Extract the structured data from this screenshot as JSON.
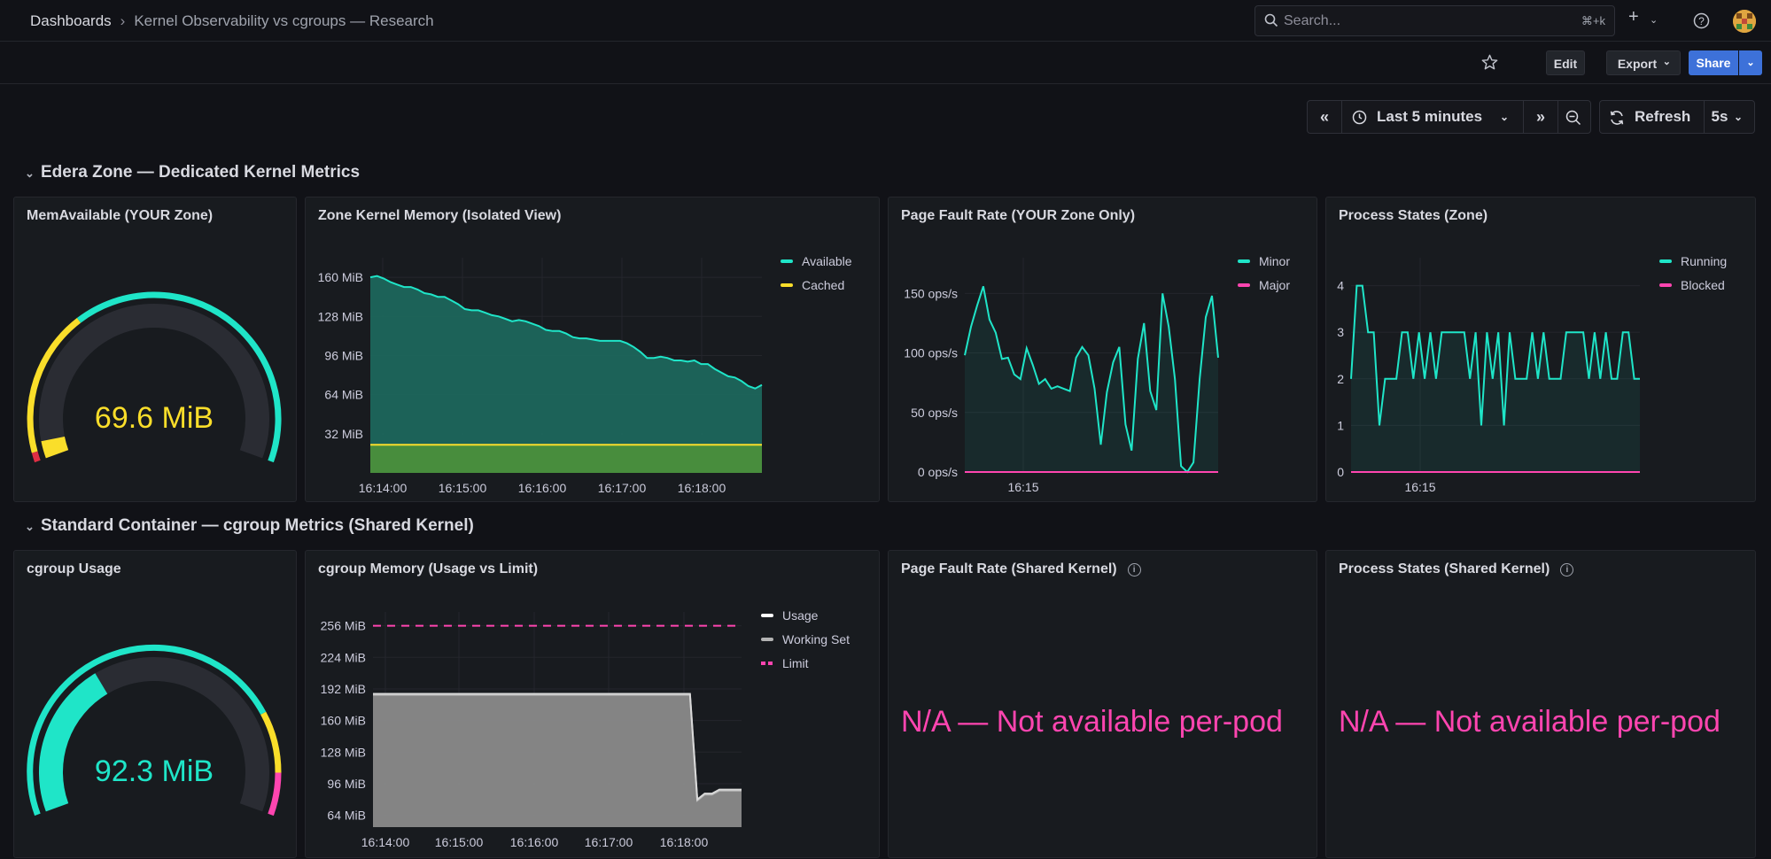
{
  "breadcrumb": {
    "root": "Dashboards",
    "separator": "›",
    "current": "Kernel Observability vs cgroups — Research"
  },
  "search": {
    "placeholder": "Search...",
    "shortcut": "⌘+k"
  },
  "toolbar": {
    "edit": "Edit",
    "export": "Export",
    "share": "Share"
  },
  "time": {
    "range": "Last 5 minutes",
    "refresh": "Refresh",
    "interval": "5s"
  },
  "rows": [
    {
      "title": "Edera Zone — Dedicated Kernel Metrics"
    },
    {
      "title": "Standard Container — cgroup Metrics (Shared Kernel)"
    }
  ],
  "colors": {
    "green": "#1fe5c8",
    "yellow": "#fade2a",
    "pink": "#ff45b0",
    "red": "#e02f44",
    "white": "#ffffff",
    "gray": "#b3b3b3"
  },
  "panels": {
    "mem_available": {
      "title": "MemAvailable (YOUR Zone)",
      "value": "69.6 MiB"
    },
    "zone_kernel": {
      "title": "Zone Kernel Memory (Isolated View)"
    },
    "page_fault_zone": {
      "title": "Page Fault Rate (YOUR Zone Only)"
    },
    "proc_zone": {
      "title": "Process States (Zone)"
    },
    "cgroup_usage": {
      "title": "cgroup Usage",
      "value": "92.3 MiB"
    },
    "cgroup_memory": {
      "title": "cgroup Memory (Usage vs Limit)"
    },
    "page_fault_shared": {
      "title": "Page Fault Rate (Shared Kernel)",
      "text": "N/A — Not available per-pod"
    },
    "proc_shared": {
      "title": "Process States (Shared Kernel)",
      "text": "N/A — Not available per-pod"
    }
  },
  "chart_data": [
    {
      "panel": "mem_available",
      "type": "gauge",
      "value": 69.6,
      "unit": "MiB",
      "fraction": 0.04,
      "thresholds": [
        "red",
        "yellow",
        "green"
      ]
    },
    {
      "panel": "zone_kernel",
      "type": "area",
      "yticks": [
        "160 MiB",
        "128 MiB",
        "96 MiB",
        "64 MiB",
        "32 MiB"
      ],
      "ylim": [
        0,
        176
      ],
      "xticks": [
        "16:14:00",
        "16:15:00",
        "16:16:00",
        "16:17:00",
        "16:18:00"
      ],
      "series": [
        {
          "name": "Available",
          "color": "#1fe5c8",
          "values": [
            160,
            161,
            159,
            156,
            154,
            152,
            152,
            150,
            147,
            146,
            144,
            144,
            141,
            138,
            134,
            133,
            133,
            131,
            129,
            128,
            126,
            124,
            125,
            124,
            122,
            120,
            117,
            116,
            116,
            114,
            111,
            110,
            110,
            109,
            108,
            108,
            108,
            108,
            106,
            103,
            99,
            94,
            94,
            95,
            94,
            92,
            92,
            91,
            92,
            89,
            89,
            85,
            82,
            79,
            78,
            75,
            71,
            69,
            72
          ]
        },
        {
          "name": "Cached",
          "color": "#fade2a",
          "values": [
            23,
            23,
            23,
            23,
            23,
            23,
            23,
            23,
            23,
            23,
            23,
            23,
            23,
            23,
            23,
            23,
            23,
            23,
            23,
            23,
            23,
            23,
            23,
            23,
            23,
            23,
            23,
            23,
            23,
            23,
            23,
            23,
            23,
            23,
            23,
            23,
            23,
            23,
            23,
            23,
            23,
            23,
            23,
            23,
            23,
            23,
            23,
            23,
            23,
            23,
            23,
            23,
            23,
            23,
            23,
            23,
            23,
            23,
            23
          ]
        }
      ]
    },
    {
      "panel": "page_fault_zone",
      "type": "line",
      "yticks": [
        "150 ops/s",
        "100 ops/s",
        "50 ops/s",
        "0 ops/s"
      ],
      "ylim": [
        0,
        180
      ],
      "xticks": [
        "16:15"
      ],
      "series": [
        {
          "name": "Minor",
          "color": "#1fe5c8",
          "values": [
            98,
            122,
            140,
            156,
            128,
            117,
            95,
            96,
            82,
            78,
            104,
            90,
            74,
            78,
            70,
            72,
            70,
            68,
            96,
            105,
            98,
            70,
            23,
            67,
            92,
            105,
            40,
            18,
            95,
            125,
            68,
            52,
            150,
            122,
            78,
            5,
            0,
            8,
            78,
            130,
            148,
            96
          ]
        },
        {
          "name": "Major",
          "color": "#ff45b0",
          "values": [
            0,
            0,
            0,
            0,
            0,
            0,
            0,
            0,
            0,
            0,
            0,
            0,
            0,
            0,
            0,
            0,
            0,
            0,
            0,
            0,
            0,
            0,
            0,
            0,
            0,
            0,
            0,
            0,
            0,
            0,
            0,
            0,
            0,
            0,
            0,
            0,
            0,
            0,
            0,
            0,
            0,
            0
          ]
        }
      ]
    },
    {
      "panel": "proc_zone",
      "type": "line",
      "yticks": [
        "4",
        "3",
        "2",
        "1",
        "0"
      ],
      "ylim": [
        0,
        4.6
      ],
      "xticks": [
        "16:15"
      ],
      "series": [
        {
          "name": "Running",
          "color": "#1fe5c8",
          "values": [
            2,
            4,
            4,
            3,
            3,
            1,
            2,
            2,
            2,
            3,
            3,
            2,
            3,
            2,
            3,
            2,
            3,
            3,
            3,
            3,
            3,
            2,
            3,
            1,
            3,
            2,
            3,
            1,
            3,
            2,
            2,
            2,
            3,
            2,
            3,
            2,
            2,
            2,
            3,
            3,
            3,
            3,
            2,
            3,
            2,
            3,
            2,
            2,
            3,
            3,
            2,
            2
          ]
        },
        {
          "name": "Blocked",
          "color": "#ff45b0",
          "values": [
            0,
            0,
            0,
            0,
            0,
            0,
            0,
            0,
            0,
            0,
            0,
            0,
            0,
            0,
            0,
            0,
            0,
            0,
            0,
            0,
            0,
            0,
            0,
            0,
            0,
            0,
            0,
            0,
            0,
            0,
            0,
            0,
            0,
            0,
            0,
            0,
            0,
            0,
            0,
            0,
            0,
            0,
            0,
            0,
            0,
            0,
            0,
            0,
            0,
            0,
            0,
            0
          ]
        }
      ]
    },
    {
      "panel": "cgroup_usage",
      "type": "gauge",
      "value": 92.3,
      "unit": "MiB",
      "fraction": 0.36,
      "thresholds": [
        "green",
        "yellow",
        "pink"
      ]
    },
    {
      "panel": "cgroup_memory",
      "type": "area",
      "yticks": [
        "256 MiB",
        "224 MiB",
        "192 MiB",
        "160 MiB",
        "128 MiB",
        "96 MiB",
        "64 MiB"
      ],
      "ylim": [
        52,
        270
      ],
      "xticks": [
        "16:14:00",
        "16:15:00",
        "16:16:00",
        "16:17:00",
        "16:18:00"
      ],
      "series": [
        {
          "name": "Usage",
          "color": "#ffffff",
          "values": [
            187,
            187,
            187,
            187,
            187,
            187,
            187,
            187,
            187,
            187,
            187,
            187,
            187,
            187,
            187,
            187,
            187,
            187,
            187,
            187,
            187,
            187,
            187,
            187,
            187,
            187,
            187,
            187,
            187,
            187,
            187,
            187,
            187,
            187,
            187,
            187,
            187,
            187,
            187,
            187,
            187,
            187,
            187,
            187,
            80,
            86,
            86,
            90,
            90,
            90,
            90
          ]
        },
        {
          "name": "Working Set",
          "color": "#b3b3b3",
          "values": [
            186,
            186,
            186,
            186,
            186,
            186,
            186,
            186,
            186,
            186,
            186,
            186,
            186,
            186,
            186,
            186,
            186,
            186,
            186,
            186,
            186,
            186,
            186,
            186,
            186,
            186,
            186,
            186,
            186,
            186,
            186,
            186,
            186,
            186,
            186,
            186,
            186,
            186,
            186,
            186,
            186,
            186,
            186,
            186,
            79,
            85,
            85,
            89,
            89,
            89,
            89
          ]
        },
        {
          "name": "Limit",
          "color": "#ff45b0",
          "values": [
            256,
            256
          ]
        }
      ]
    }
  ]
}
